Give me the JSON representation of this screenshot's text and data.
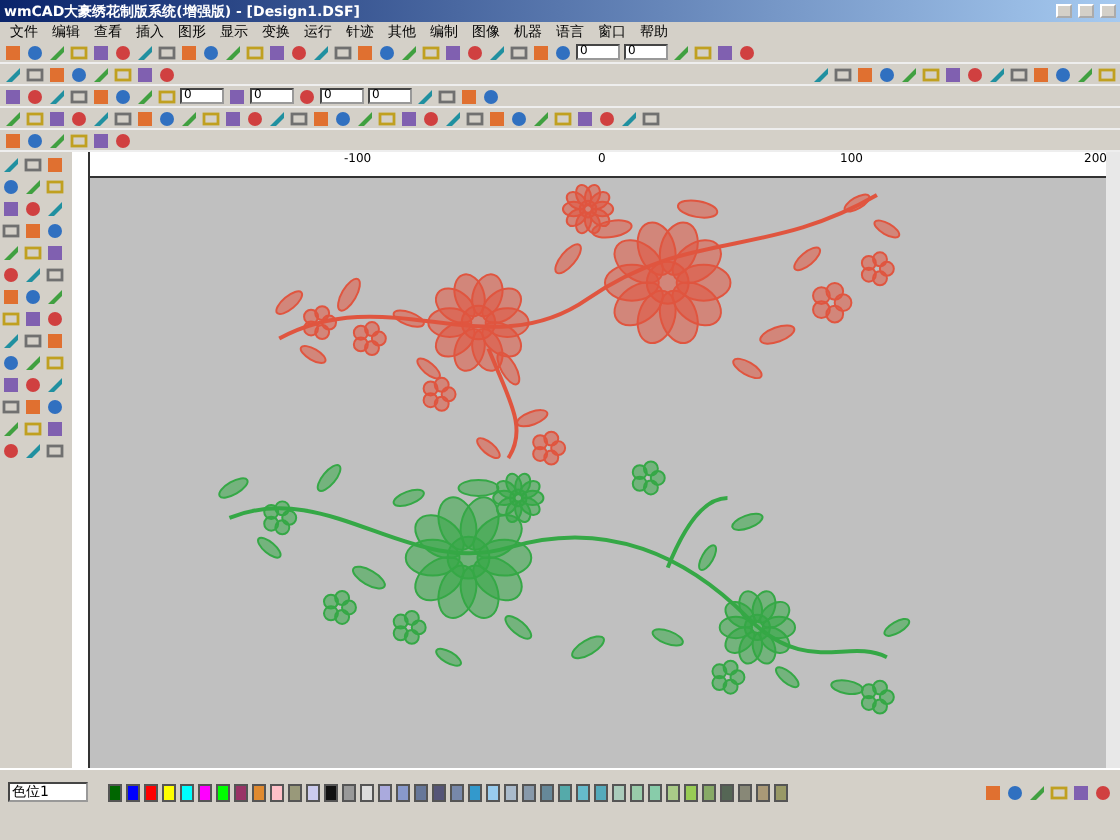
{
  "window": {
    "title": "wmCAD大豪绣花制版系统(增强版) - [Design1.DSF]"
  },
  "menu": [
    "文件",
    "编辑",
    "查看",
    "插入",
    "图形",
    "显示",
    "变换",
    "运行",
    "针迹",
    "其他",
    "编制",
    "图像",
    "机器",
    "语言",
    "窗口",
    "帮助"
  ],
  "toolbar_fields": [
    "0",
    "0",
    "0",
    "0",
    "0",
    "0"
  ],
  "ruler": {
    "labels": [
      "-100",
      "0",
      "100",
      "200"
    ]
  },
  "canvas": {
    "designs": [
      {
        "color": "#e0553f"
      },
      {
        "color": "#35a846"
      }
    ]
  },
  "status_bar": {
    "color_slot": "色位1"
  },
  "palette": [
    {
      "color": "#006600"
    },
    {
      "color": "#0000ff"
    },
    {
      "color": "#ff0000"
    },
    {
      "color": "#ffff00"
    },
    {
      "color": "#00ffff"
    },
    {
      "color": "#ff00ff"
    },
    {
      "color": "#00ff00"
    },
    {
      "color": "#993366"
    },
    {
      "color": "#e08a30"
    },
    {
      "color": "#ffc0c8"
    },
    {
      "color": "#99997a"
    },
    {
      "color": "#ccccee"
    },
    {
      "color": "#111111"
    },
    {
      "color": "#999999"
    },
    {
      "color": "#dddddd"
    },
    {
      "color": "#aaaadd"
    },
    {
      "color": "#8899cc"
    },
    {
      "color": "#667799"
    },
    {
      "color": "#555577"
    },
    {
      "color": "#7788aa"
    },
    {
      "color": "#3399cc"
    },
    {
      "color": "#99ccee"
    },
    {
      "color": "#aabbcc"
    },
    {
      "color": "#8899aa"
    },
    {
      "color": "#668899"
    },
    {
      "color": "#55aaaa"
    },
    {
      "color": "#66bbcc"
    },
    {
      "color": "#55aabb"
    },
    {
      "color": "#aaccbb"
    },
    {
      "color": "#99ccaa"
    },
    {
      "color": "#88ccaa"
    },
    {
      "color": "#aacc88"
    },
    {
      "color": "#99cc55"
    },
    {
      "color": "#88aa66"
    },
    {
      "color": "#556655"
    },
    {
      "color": "#888877"
    },
    {
      "color": "#aa9977"
    },
    {
      "color": "#999966"
    }
  ]
}
